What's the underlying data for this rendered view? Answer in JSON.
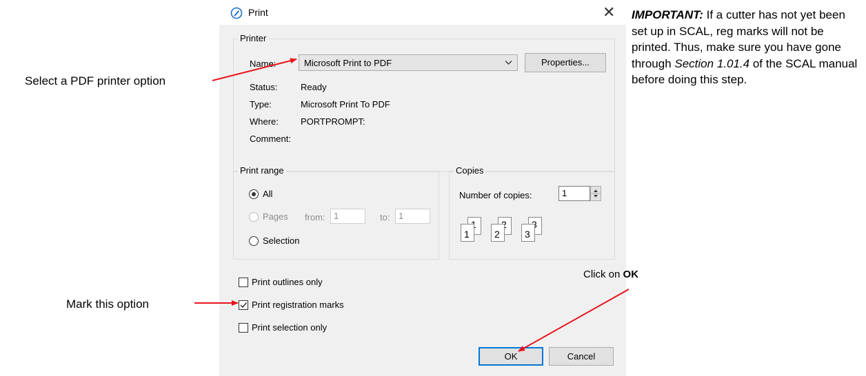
{
  "dialog": {
    "title": "Print",
    "printer_group": {
      "legend": "Printer",
      "name_label": "Name:",
      "name_value": "Microsoft Print to PDF",
      "properties_button": "Properties...",
      "status_label": "Status:",
      "status_value": "Ready",
      "type_label": "Type:",
      "type_value": "Microsoft Print To PDF",
      "where_label": "Where:",
      "where_value": "PORTPROMPT:",
      "comment_label": "Comment:"
    },
    "range_group": {
      "legend": "Print range",
      "all_label": "All",
      "all_selected": true,
      "pages_label": "Pages",
      "from_label": "from:",
      "from_value": "1",
      "to_label": "to:",
      "to_value": "1",
      "selection_label": "Selection"
    },
    "copies_group": {
      "legend": "Copies",
      "number_label": "Number of copies:",
      "number_value": "1",
      "collate_digits": [
        "1",
        "1",
        "2",
        "2",
        "3",
        "3"
      ]
    },
    "options": [
      {
        "label": "Print outlines only",
        "checked": false
      },
      {
        "label": "Print registration marks",
        "checked": true
      },
      {
        "label": "Print selection only",
        "checked": false
      }
    ],
    "ok_button": "OK",
    "cancel_button": "Cancel"
  },
  "annotations": {
    "note_prefix": "IMPORTANT:",
    "note_part1": " If a cutter has not yet been set up in SCAL, reg marks will not be printed. Thus, make sure you have gone through ",
    "note_section": "Section 1.01.4",
    "note_part2": " of the SCAL manual before doing this step.",
    "select_pdf": "Select a PDF printer option",
    "mark_option": "Mark this option",
    "click_on": "Click on ",
    "click_ok": "OK"
  },
  "colors": {
    "arrow": "#e8141c",
    "accent": "#0078d7",
    "dialog_bg": "#f0f0f0"
  }
}
